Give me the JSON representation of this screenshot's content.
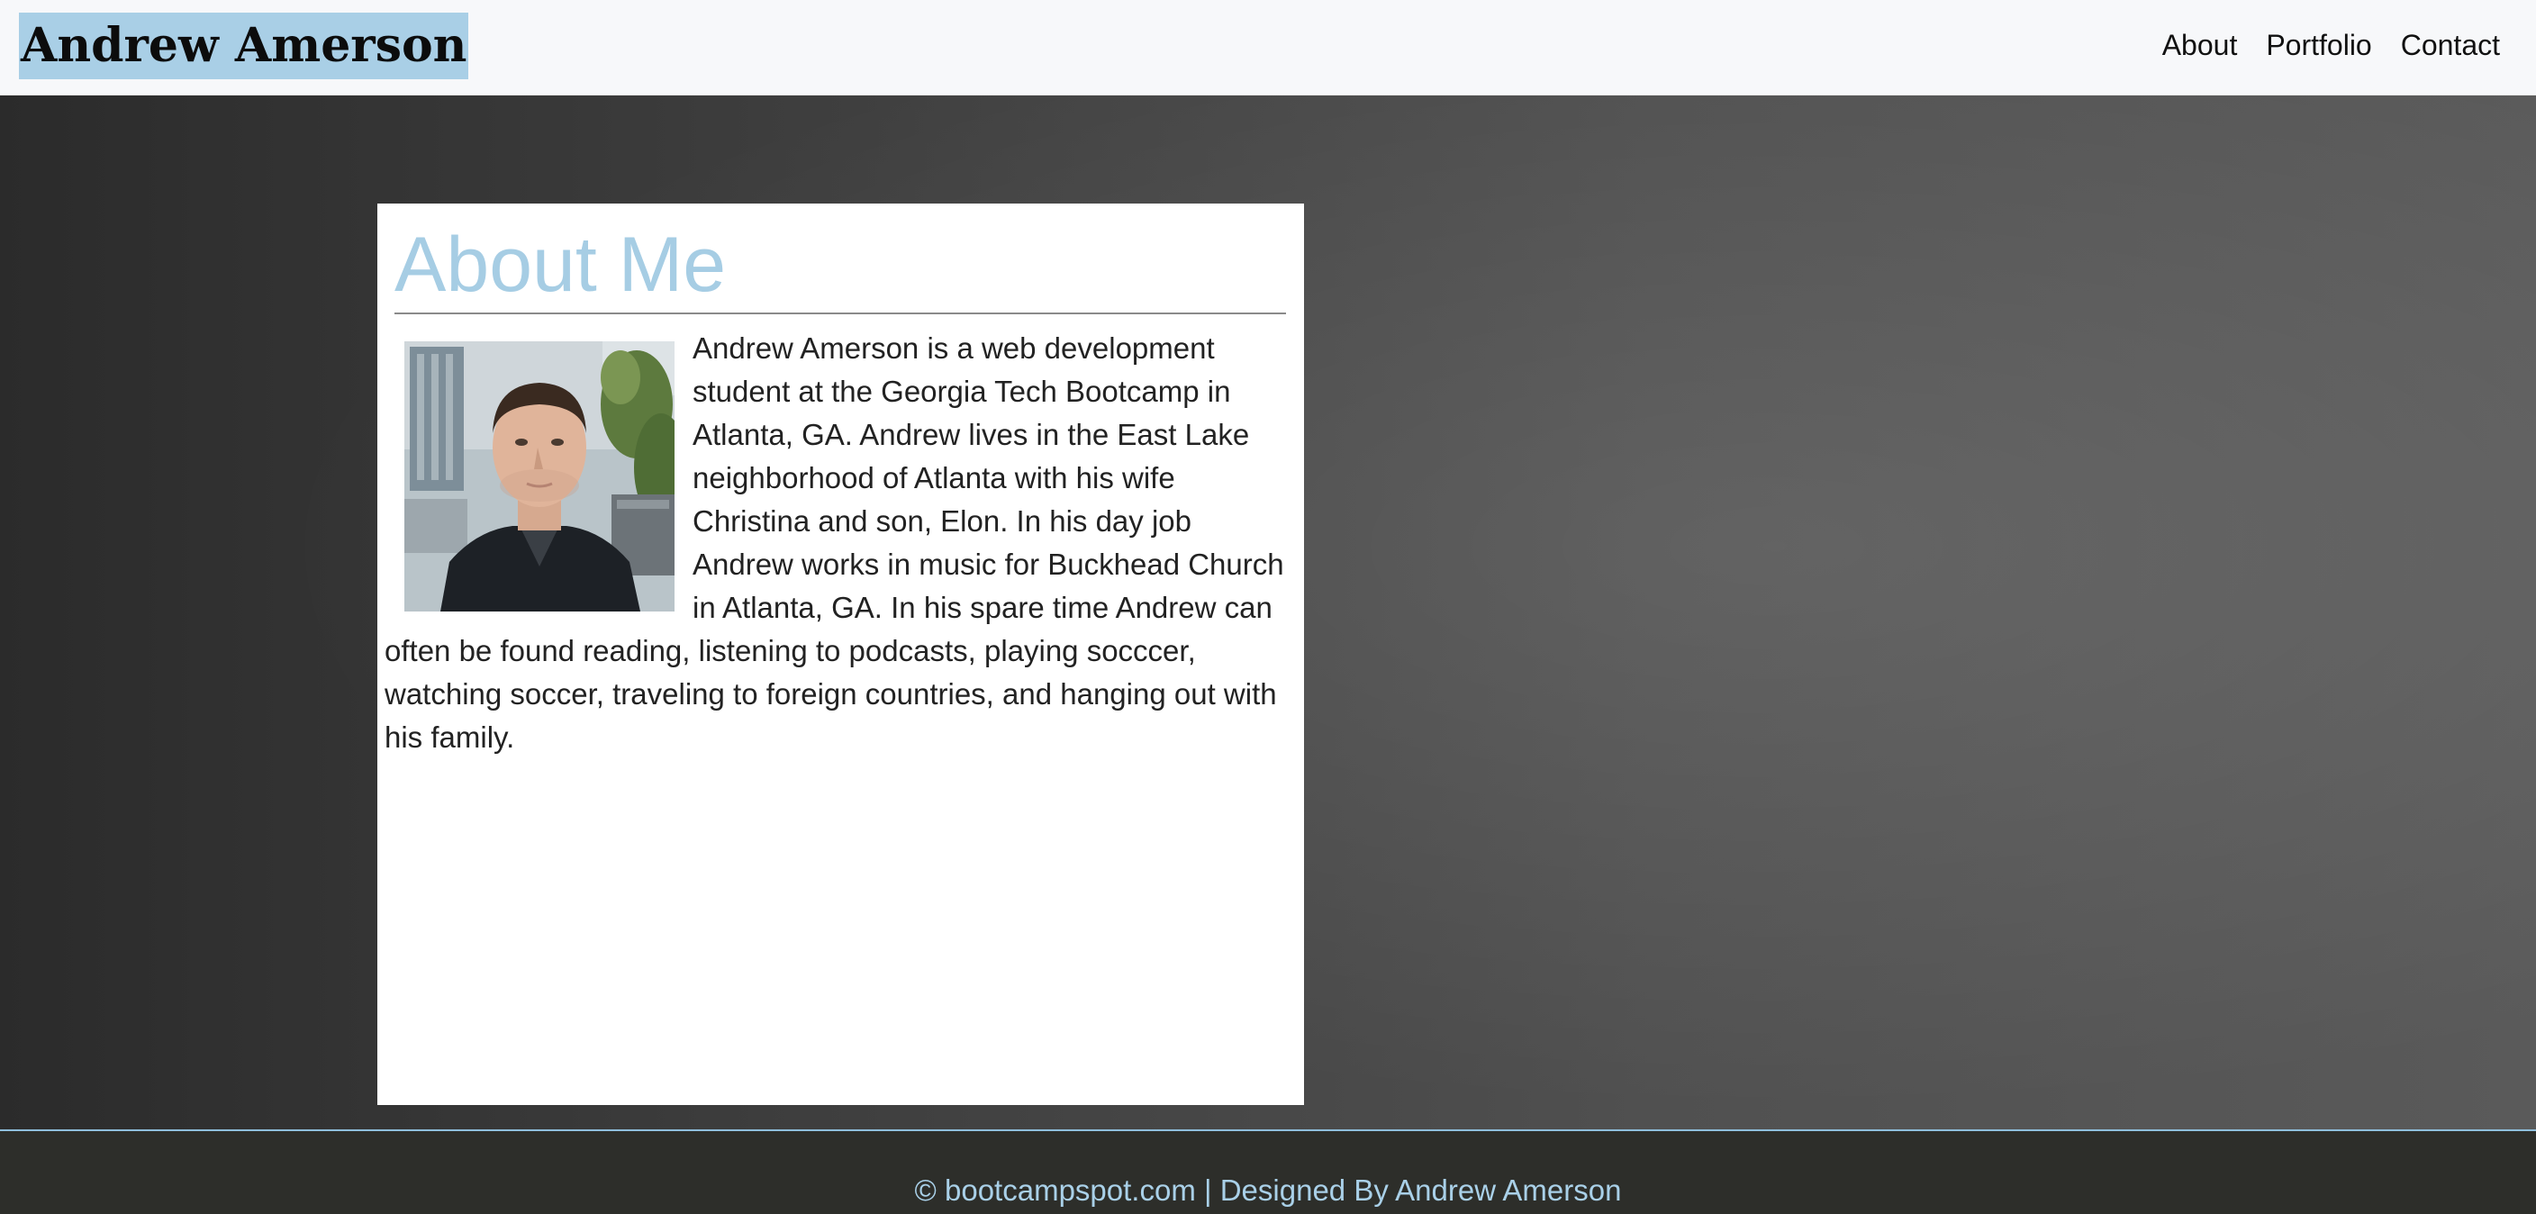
{
  "navbar": {
    "brand": "Andrew Amerson",
    "links": [
      "About",
      "Portfolio",
      "Contact"
    ]
  },
  "about": {
    "title": "About Me",
    "body": "Andrew Amerson is a web development student at the Georgia Tech Bootcamp in Atlanta, GA. Andrew lives in the East Lake neighborhood of Atlanta with his wife Christina and son, Elon. In his day job Andrew works in music for Buckhead Church in Atlanta, GA. In his spare time Andrew can often be found reading, listening to podcasts, playing socccer, watching soccer, traveling to foreign countries, and hanging out with his family.",
    "photo": "profile-photo"
  },
  "footer": {
    "text": "© bootcampspot.com | Designed By Andrew Amerson"
  },
  "colors": {
    "accent": "#a6cde4",
    "brand_highlight": "#a9cfe6",
    "footer_bg": "#2d2e2a",
    "navbar_bg": "#f7f8fa"
  }
}
